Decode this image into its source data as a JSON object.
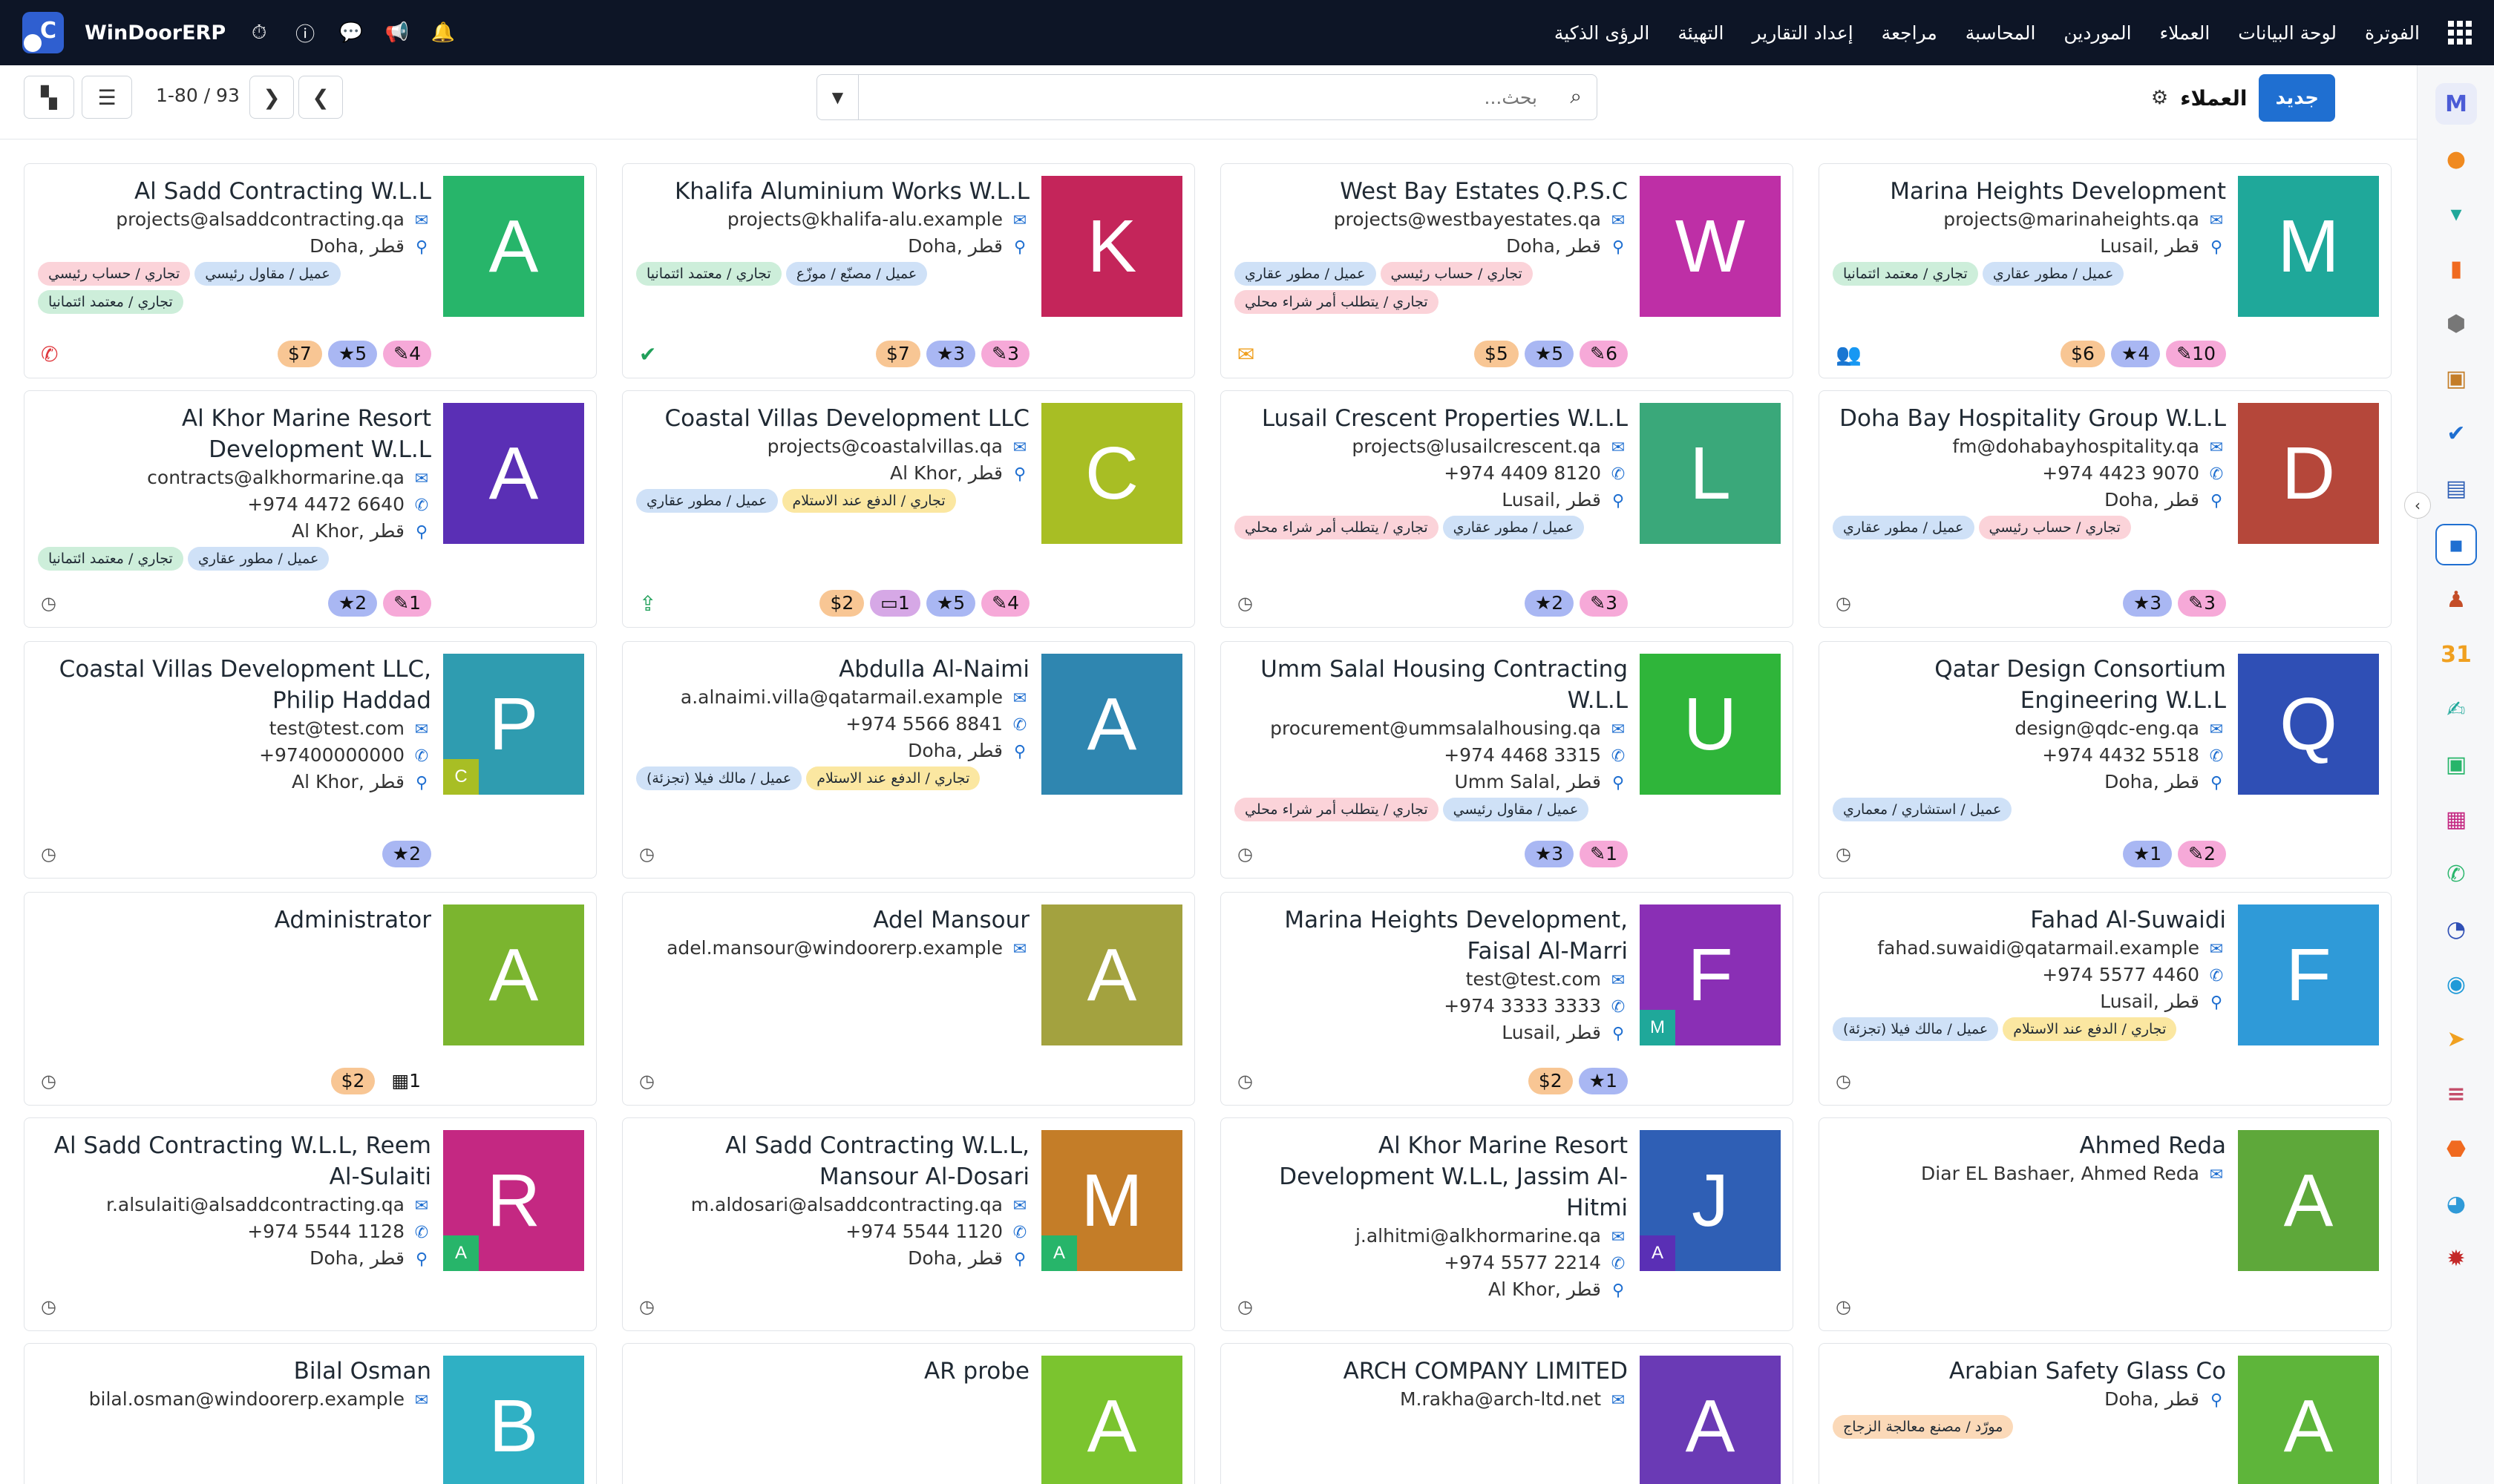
{
  "nav": {
    "brand": "WinDoorERP",
    "menu": [
      "الفوترة",
      "لوحة البيانات",
      "العملاء",
      "الموردين",
      "المحاسبة",
      "مراجعة",
      "إعداد التقارير",
      "التهيئة",
      "الرؤى الذكية"
    ]
  },
  "controls": {
    "new_label": "جديد",
    "title": "العملاء",
    "search_placeholder": "بحث...",
    "pager": "1-80 / 93"
  },
  "colors": {
    "accent": "#1f6fd1",
    "topbar": "#0d1526",
    "tag_green": "#cdeeda",
    "tag_pink": "#fbd3d9",
    "tag_blue": "#cfe1f7",
    "tag_yellow": "#fbe7a1",
    "tag_orange": "#fbd9b8",
    "badge_orange": "#f8c694",
    "badge_blue": "#a9b7f3",
    "badge_pink": "#f6a9d8",
    "badge_purple": "#d6a8e6"
  },
  "cards": [
    {
      "initial": "A",
      "color": "#27b56a",
      "name": "Al Sadd Contracting W.L.L",
      "email": "projects@alsaddcontracting.qa",
      "location": "Doha, قطر",
      "tags": [
        {
          "t": "عميل / مقاول رئيسي",
          "c": "tag_blue"
        },
        {
          "t": "تجاري / حساب رئيسي",
          "c": "tag_pink"
        },
        {
          "t": "تجاري / معتمد ائتمانيا",
          "c": "tag_green"
        }
      ],
      "action": "phone-icon",
      "action_glyph": "✆",
      "action_color": "#e0393e",
      "badges": [
        {
          "t": "$7",
          "c": "badge_orange"
        },
        {
          "t": "★5",
          "c": "badge_blue"
        },
        {
          "t": "✎4",
          "c": "badge_pink"
        }
      ]
    },
    {
      "initial": "K",
      "color": "#c4255a",
      "name": "Khalifa Aluminium Works W.L.L",
      "email": "projects@khalifa-alu.example",
      "location": "Doha, قطر",
      "tags": [
        {
          "t": "عميل / مصنّع / موزّع",
          "c": "tag_blue"
        },
        {
          "t": "تجاري / معتمد ائتمانيا",
          "c": "tag_green"
        }
      ],
      "action": "check-icon",
      "action_glyph": "✔",
      "action_color": "#21a05a",
      "badges": [
        {
          "t": "$7",
          "c": "badge_orange"
        },
        {
          "t": "★3",
          "c": "badge_blue"
        },
        {
          "t": "✎3",
          "c": "badge_pink"
        }
      ]
    },
    {
      "initial": "W",
      "color": "#be2fa6",
      "name": "West Bay Estates Q.P.S.C",
      "email": "projects@westbayestates.qa",
      "location": "Doha, قطر",
      "tags": [
        {
          "t": "تجاري / حساب رئيسي",
          "c": "tag_pink"
        },
        {
          "t": "عميل / مطور عقاري",
          "c": "tag_blue"
        },
        {
          "t": "تجاري / يتطلب أمر شراء محلي",
          "c": "tag_pink"
        }
      ],
      "action": "envelope-icon",
      "action_glyph": "✉",
      "action_color": "#f0a020",
      "badges": [
        {
          "t": "$5",
          "c": "badge_orange"
        },
        {
          "t": "★5",
          "c": "badge_blue"
        },
        {
          "t": "✎6",
          "c": "badge_pink"
        }
      ]
    },
    {
      "initial": "M",
      "color": "#1fa89a",
      "name": "Marina Heights Development",
      "email": "projects@marinaheights.qa",
      "location": "Lusail, قطر",
      "tags": [
        {
          "t": "عميل / مطور عقاري",
          "c": "tag_blue"
        },
        {
          "t": "تجاري / معتمد ائتمانيا",
          "c": "tag_green"
        }
      ],
      "action": "users-icon",
      "action_glyph": "👥",
      "action_color": "#21a05a",
      "badges": [
        {
          "t": "$6",
          "c": "badge_orange"
        },
        {
          "t": "★4",
          "c": "badge_blue"
        },
        {
          "t": "✎10",
          "c": "badge_pink"
        }
      ]
    },
    {
      "initial": "A",
      "color": "#5a2fb5",
      "name": "Al Khor Marine Resort Development W.L.L",
      "email": "contracts@alkhormarine.qa",
      "phone": "+974 4472 6640",
      "location": "Al Khor, قطر",
      "tags": [
        {
          "t": "عميل / مطور عقاري",
          "c": "tag_blue"
        },
        {
          "t": "تجاري / معتمد ائتمانيا",
          "c": "tag_green"
        }
      ],
      "action": "clock-icon",
      "badges": [
        {
          "t": "★2",
          "c": "badge_blue"
        },
        {
          "t": "✎1",
          "c": "badge_pink"
        }
      ]
    },
    {
      "initial": "C",
      "color": "#a8be24",
      "name": "Coastal Villas Development LLC",
      "email": "projects@coastalvillas.qa",
      "location": "Al Khor, قطر",
      "tags": [
        {
          "t": "تجاري / الدفع عند الاستلام",
          "c": "tag_yellow"
        },
        {
          "t": "عميل / مطور عقاري",
          "c": "tag_blue"
        }
      ],
      "action": "upload-icon",
      "action_glyph": "⇪",
      "action_color": "#21a05a",
      "badges": [
        {
          "t": "$2",
          "c": "badge_orange"
        },
        {
          "t": "▭1",
          "c": "badge_purple"
        },
        {
          "t": "★5",
          "c": "badge_blue"
        },
        {
          "t": "✎4",
          "c": "badge_pink"
        }
      ]
    },
    {
      "initial": "L",
      "color": "#3aa87a",
      "name": "Lusail Crescent Properties W.L.L",
      "email": "projects@lusailcrescent.qa",
      "phone": "+974 4409 8120",
      "location": "Lusail, قطر",
      "tags": [
        {
          "t": "عميل / مطور عقاري",
          "c": "tag_blue"
        },
        {
          "t": "تجاري / يتطلب أمر شراء محلي",
          "c": "tag_pink"
        }
      ],
      "action": "clock-icon",
      "badges": [
        {
          "t": "★2",
          "c": "badge_blue"
        },
        {
          "t": "✎3",
          "c": "badge_pink"
        }
      ]
    },
    {
      "initial": "D",
      "color": "#b5473a",
      "name": "Doha Bay Hospitality Group W.L.L",
      "email": "fm@dohabayhospitality.qa",
      "phone": "+974 4423 9070",
      "location": "Doha, قطر",
      "tags": [
        {
          "t": "تجاري / حساب رئيسي",
          "c": "tag_pink"
        },
        {
          "t": "عميل / مطور عقاري",
          "c": "tag_blue"
        }
      ],
      "action": "clock-icon",
      "badges": [
        {
          "t": "★3",
          "c": "badge_blue"
        },
        {
          "t": "✎3",
          "c": "badge_pink"
        }
      ]
    },
    {
      "initial": "P",
      "color": "#2f9cb0",
      "mini": "C",
      "mini_color": "#a8be24",
      "name": "Coastal Villas Development LLC, Philip Haddad",
      "email": "test@test.com",
      "phone": "+97400000000",
      "location": "Al Khor, قطر",
      "tags": [],
      "action": "clock-icon",
      "badges": [
        {
          "t": "★2",
          "c": "badge_blue"
        }
      ]
    },
    {
      "initial": "A",
      "color": "#2f86b0",
      "name": "Abdulla Al-Naimi",
      "email": "a.alnaimi.villa@qatarmail.example",
      "phone": "+974 5566 8841",
      "location": "Doha, قطر",
      "tags": [
        {
          "t": "تجاري / الدفع عند الاستلام",
          "c": "tag_yellow"
        },
        {
          "t": "عميل / مالك فيلا (تجزئة)",
          "c": "tag_blue"
        }
      ],
      "action": "clock-icon",
      "badges": []
    },
    {
      "initial": "U",
      "color": "#2fb53a",
      "name": "Umm Salal Housing Contracting W.L.L",
      "email": "procurement@ummsalalhousing.qa",
      "phone": "+974 4468 3315",
      "location": "Umm Salal, قطر",
      "tags": [
        {
          "t": "عميل / مقاول رئيسي",
          "c": "tag_blue"
        },
        {
          "t": "تجاري / يتطلب أمر شراء محلي",
          "c": "tag_pink"
        }
      ],
      "action": "clock-icon",
      "badges": [
        {
          "t": "★3",
          "c": "badge_blue"
        },
        {
          "t": "✎1",
          "c": "badge_pink"
        }
      ]
    },
    {
      "initial": "Q",
      "color": "#2f4fb5",
      "name": "Qatar Design Consortium Engineering W.L.L",
      "email": "design@qdc-eng.qa",
      "phone": "+974 4432 5518",
      "location": "Doha, قطر",
      "tags": [
        {
          "t": "عميل / استشاري / معماري",
          "c": "tag_blue"
        }
      ],
      "action": "clock-icon",
      "badges": [
        {
          "t": "★1",
          "c": "badge_blue"
        },
        {
          "t": "✎2",
          "c": "badge_pink"
        }
      ]
    },
    {
      "initial": "A",
      "color": "#7bb52f",
      "name": "Administrator",
      "tags": [],
      "action": "clock-icon",
      "badges": [
        {
          "t": "$2",
          "c": "badge_orange"
        },
        {
          "t": "▦1",
          "c": "badge_yellow"
        }
      ]
    },
    {
      "initial": "A",
      "color": "#a3a23f",
      "name": "Adel Mansour",
      "email": "adel.mansour@windoorerp.example",
      "tags": [],
      "action": "clock-icon",
      "badges": []
    },
    {
      "initial": "F",
      "color": "#8a2fb5",
      "mini": "M",
      "mini_color": "#1fa89a",
      "name": "Marina Heights Development, Faisal Al-Marri",
      "email": "test@test.com",
      "phone": "+974 3333 3333",
      "location": "Lusail, قطر",
      "tags": [],
      "action": "clock-icon",
      "badges": [
        {
          "t": "$2",
          "c": "badge_orange"
        },
        {
          "t": "★1",
          "c": "badge_blue"
        }
      ]
    },
    {
      "initial": "F",
      "color": "#2f9ad8",
      "name": "Fahad Al-Suwaidi",
      "email": "fahad.suwaidi@qatarmail.example",
      "phone": "+974 5577 4460",
      "location": "Lusail, قطر",
      "tags": [
        {
          "t": "تجاري / الدفع عند الاستلام",
          "c": "tag_yellow"
        },
        {
          "t": "عميل / مالك فيلا (تجزئة)",
          "c": "tag_blue"
        }
      ],
      "action": "clock-icon",
      "badges": []
    },
    {
      "initial": "R",
      "color": "#c42882",
      "mini": "A",
      "mini_color": "#27b56a",
      "name": "Al Sadd Contracting W.L.L, Reem Al-Sulaiti",
      "email": "r.alsulaiti@alsaddcontracting.qa",
      "phone": "+974 5544 1128",
      "location": "Doha, قطر",
      "tags": [],
      "action": "clock-icon",
      "badges": []
    },
    {
      "initial": "M",
      "color": "#c47d28",
      "mini": "A",
      "mini_color": "#27b56a",
      "name": "Al Sadd Contracting W.L.L, Mansour Al-Dosari",
      "email": "m.aldosari@alsaddcontracting.qa",
      "phone": "+974 5544 1120",
      "location": "Doha, قطر",
      "tags": [],
      "action": "clock-icon",
      "badges": []
    },
    {
      "initial": "J",
      "color": "#2f5fb5",
      "mini": "A",
      "mini_color": "#5a2fb5",
      "name": "Al Khor Marine Resort Development W.L.L, Jassim Al-Hitmi",
      "email": "j.alhitmi@alkhormarine.qa",
      "phone": "+974 5577 2214",
      "location": "Al Khor, قطر",
      "tags": [],
      "action": "clock-icon",
      "badges": []
    },
    {
      "initial": "A",
      "color": "#5ea83a",
      "name": "Ahmed Reda",
      "email": "Diar EL Bashaer, Ahmed Reda",
      "tags": [],
      "action": "clock-icon",
      "badges": []
    },
    {
      "initial": "B",
      "color": "#2fb0c4",
      "name": "Bilal Osman",
      "email": "bilal.osman@windoorerp.example",
      "tags": [],
      "action": "clock-icon",
      "badges": []
    },
    {
      "initial": "A",
      "color": "#7bc42f",
      "name": "AR probe",
      "tags": [],
      "action": "clock-icon",
      "badges": []
    },
    {
      "initial": "A",
      "color": "#6a3ab5",
      "name": "ARCH COMPANY LIMITED",
      "email": "M.rakha@arch-ltd.net",
      "tags": [],
      "action": "clock-icon",
      "badges": [
        {
          "t": "▭",
          "c": "badge_purple"
        }
      ]
    },
    {
      "initial": "A",
      "color": "#5eb53a",
      "name": "Arabian Safety Glass Co",
      "location": "Doha, قطر",
      "tags": [
        {
          "t": "مورّد / مصنع معالجة الزجاج",
          "c": "tag_orange"
        }
      ],
      "action": "clock-icon",
      "badges": [
        {
          "t": "▭",
          "c": "badge_purple"
        },
        {
          "t": "✎",
          "c": "badge_pink"
        }
      ]
    }
  ]
}
